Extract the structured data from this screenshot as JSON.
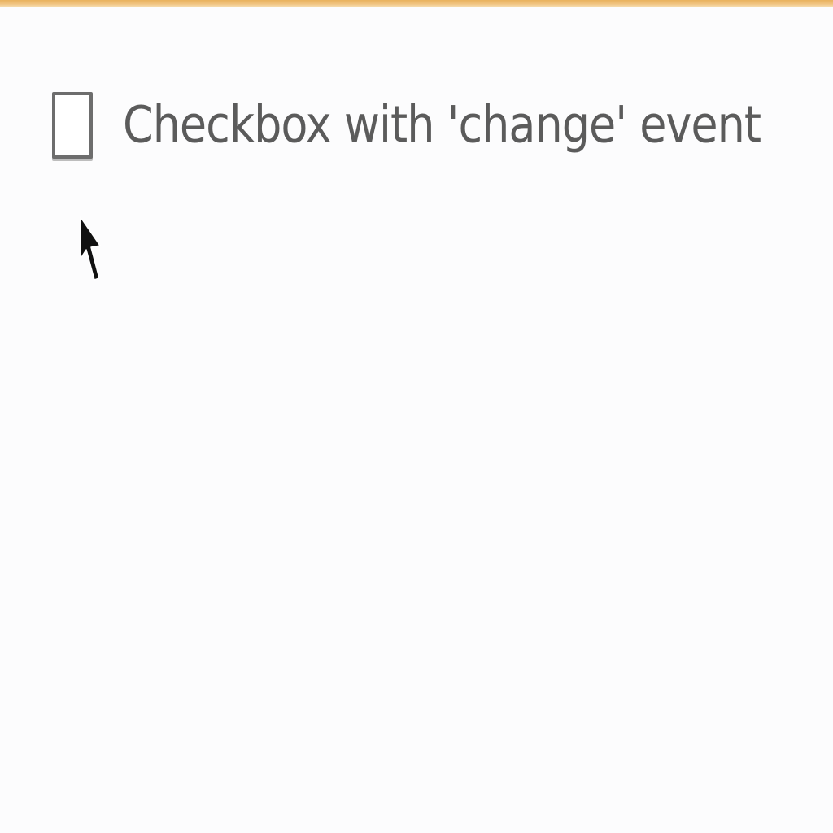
{
  "theme": {
    "accent_bar": "#e9b25e",
    "background": "#fcfcfd",
    "text": "#5b5b5b",
    "checkbox_border": "#6d6d6d"
  },
  "checkbox": {
    "label": "Checkbox with 'change' event",
    "checked": false
  },
  "cursor": {
    "icon": "arrow-pointer-icon"
  }
}
